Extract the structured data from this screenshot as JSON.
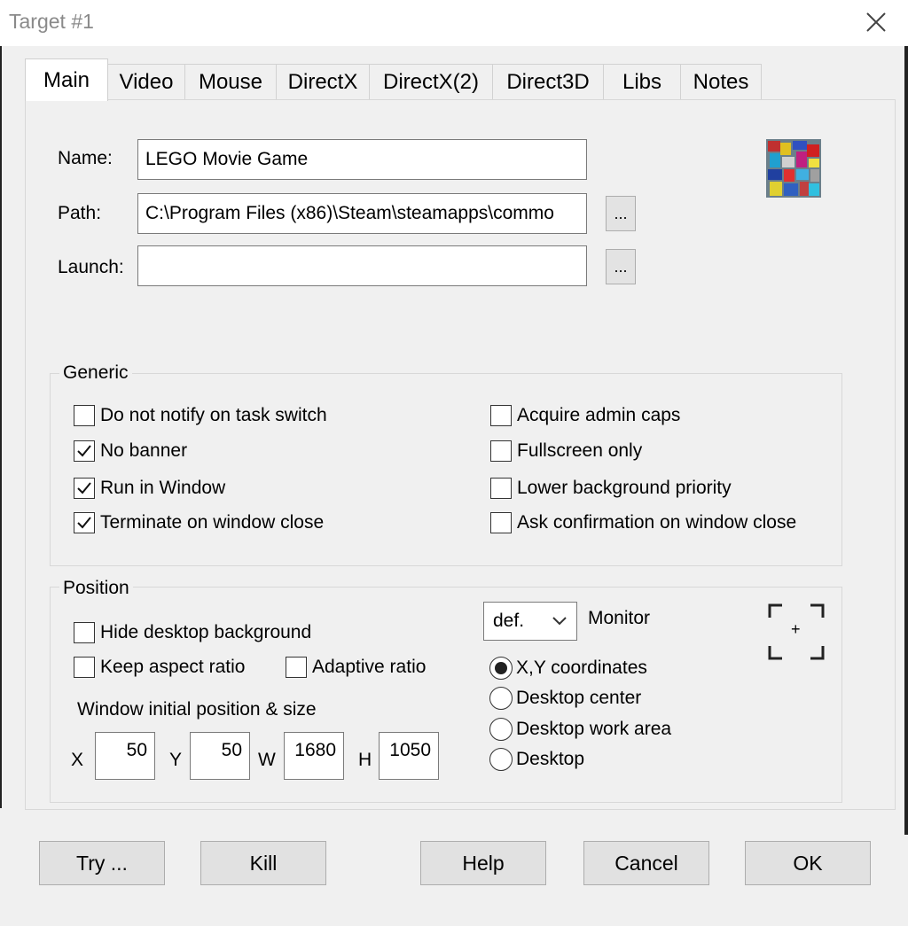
{
  "window": {
    "title": "Target #1"
  },
  "tabs": [
    {
      "label": "Main",
      "active": true
    },
    {
      "label": "Video"
    },
    {
      "label": "Mouse"
    },
    {
      "label": "DirectX"
    },
    {
      "label": "DirectX(2)"
    },
    {
      "label": "Direct3D"
    },
    {
      "label": "Libs"
    },
    {
      "label": "Notes"
    }
  ],
  "main": {
    "name_label": "Name:",
    "name_value": "LEGO Movie Game",
    "path_label": "Path:",
    "path_value": "C:\\Program Files (x86)\\Steam\\steamapps\\commo",
    "launch_label": "Launch:",
    "launch_value": "",
    "browse_label": "...",
    "icon": "game-thumbnail-icon"
  },
  "generic": {
    "title": "Generic",
    "options": [
      {
        "label": "Do not notify on task switch",
        "checked": false
      },
      {
        "label": "No banner",
        "checked": true
      },
      {
        "label": "Run in Window",
        "checked": true
      },
      {
        "label": "Terminate on window close",
        "checked": true
      },
      {
        "label": "Acquire admin caps",
        "checked": false
      },
      {
        "label": "Fullscreen only",
        "checked": false
      },
      {
        "label": "Lower background priority",
        "checked": false
      },
      {
        "label": "Ask confirmation on window close",
        "checked": false
      }
    ]
  },
  "position": {
    "title": "Position",
    "hide_desktop": {
      "label": "Hide desktop background",
      "checked": false
    },
    "keep_aspect": {
      "label": "Keep aspect ratio",
      "checked": false
    },
    "adaptive_ratio": {
      "label": "Adaptive ratio",
      "checked": false
    },
    "initial_label": "Window initial position & size",
    "x_label": "X",
    "x_value": "50",
    "y_label": "Y",
    "y_value": "50",
    "w_label": "W",
    "w_value": "1680",
    "h_label": "H",
    "h_value": "1050",
    "monitor_select": "def.",
    "monitor_label": "Monitor",
    "radios": [
      {
        "label": "X,Y coordinates",
        "selected": true
      },
      {
        "label": "Desktop center",
        "selected": false
      },
      {
        "label": "Desktop work area",
        "selected": false
      },
      {
        "label": "Desktop",
        "selected": false
      }
    ],
    "capture_button_glyph": "+"
  },
  "buttons": {
    "try": "Try ...",
    "kill": "Kill",
    "help": "Help",
    "cancel": "Cancel",
    "ok": "OK"
  },
  "colors": {
    "window_bg": "#f0f0f0",
    "title_text": "#8a8a8a",
    "tab_active_bg": "#ffffff"
  }
}
